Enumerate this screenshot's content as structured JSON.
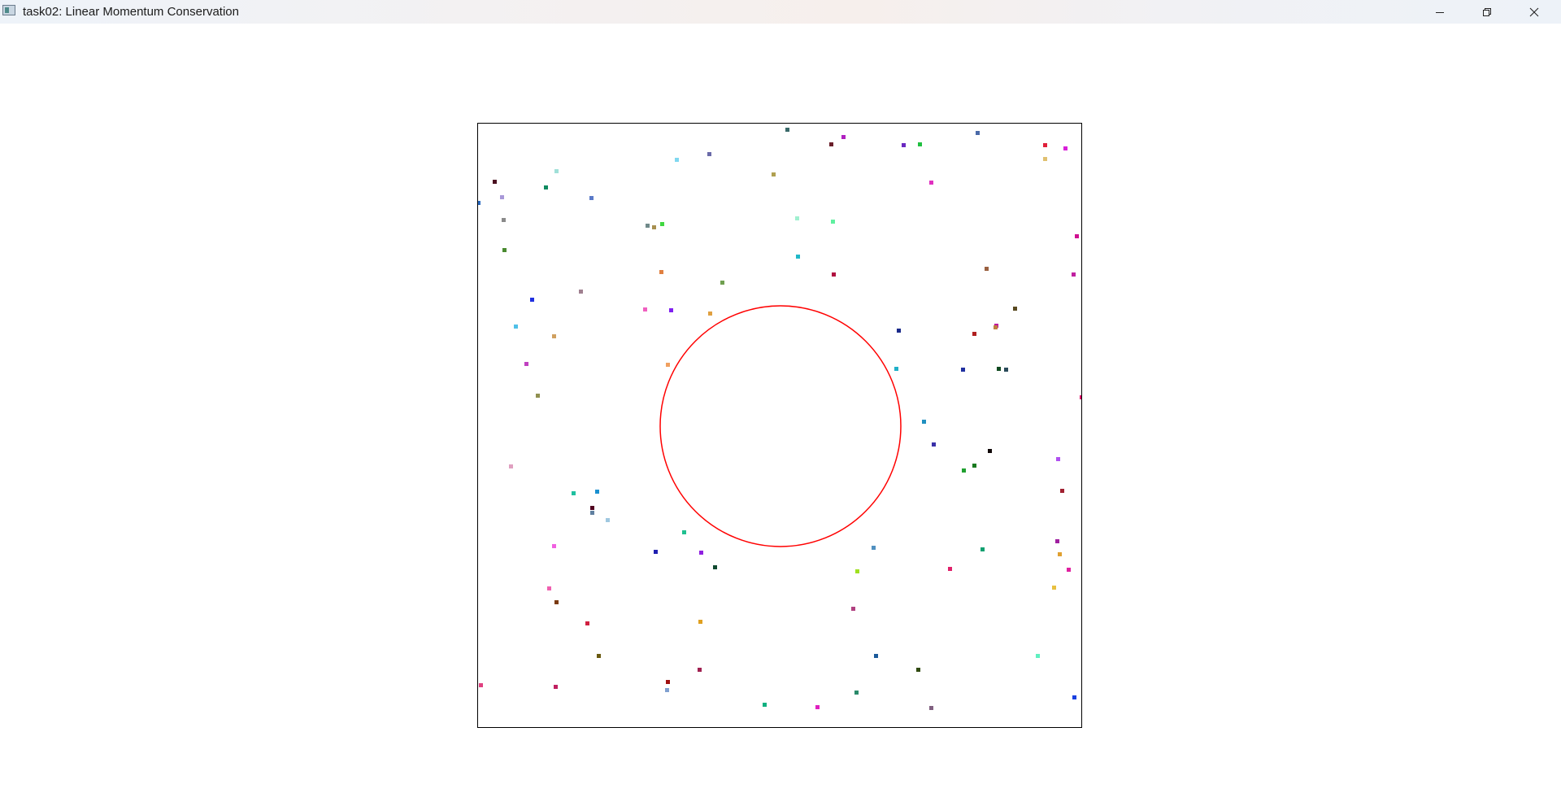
{
  "window": {
    "title": "task02: Linear Momentum Conservation",
    "controls": [
      "minimize",
      "restore",
      "close"
    ]
  },
  "simulation": {
    "circle_color": "#ff0000",
    "border_color": "#000000",
    "particles": [
      {
        "color": "#3a6a6a"
      },
      {
        "color": "#6a1f2a"
      },
      {
        "color": "#b020c0"
      },
      {
        "color": "#6a28c0"
      },
      {
        "color": "#20c040"
      },
      {
        "color": "#4a6aa8"
      },
      {
        "color": "#e0203a"
      },
      {
        "color": "#d820d8"
      },
      {
        "color": "#e0c070"
      },
      {
        "color": "#80d8f0"
      },
      {
        "color": "#6a6aa8"
      },
      {
        "color": "#b0a050"
      },
      {
        "color": "#e030c0"
      },
      {
        "color": "#a0e0d8"
      },
      {
        "color": "#4a1020"
      },
      {
        "color": "#108a60"
      },
      {
        "color": "#5a7ac8"
      },
      {
        "color": "#a898d8"
      },
      {
        "color": "#2a6ac0"
      },
      {
        "color": "#8a8a8a"
      },
      {
        "color": "#a0f0d0"
      },
      {
        "color": "#60f0a0"
      },
      {
        "color": "#708a8a"
      },
      {
        "color": "#a89050"
      },
      {
        "color": "#40d840"
      },
      {
        "color": "#d01090"
      },
      {
        "color": "#4a8a30"
      },
      {
        "color": "#20b8c8"
      },
      {
        "color": "#b01040"
      },
      {
        "color": "#c010a0"
      },
      {
        "color": "#c020a0"
      },
      {
        "color": "#9a6040"
      },
      {
        "color": "#e08040"
      },
      {
        "color": "#70a050"
      },
      {
        "color": "#a08090"
      },
      {
        "color": "#5a4a20"
      },
      {
        "color": "#2030e0"
      },
      {
        "color": "#f060c0"
      },
      {
        "color": "#8020f0"
      },
      {
        "color": "#e0a040"
      },
      {
        "color": "#50c0e8"
      },
      {
        "color": "#d0a060"
      },
      {
        "color": "#1a2a8a"
      },
      {
        "color": "#b02020"
      },
      {
        "color": "#c08040"
      },
      {
        "color": "#c040c0"
      },
      {
        "color": "#f0a060"
      },
      {
        "color": "#20b0c8"
      },
      {
        "color": "#2030a0"
      },
      {
        "color": "#104a20"
      },
      {
        "color": "#2a4a5a"
      },
      {
        "color": "#e0106a"
      },
      {
        "color": "#909050"
      },
      {
        "color": "#2090c0"
      },
      {
        "color": "#3a30a8"
      },
      {
        "color": "#100808"
      },
      {
        "color": "#e0a0c0"
      },
      {
        "color": "#b050f0"
      },
      {
        "color": "#1a7a20"
      },
      {
        "color": "#20a030"
      },
      {
        "color": "#20c0a0"
      },
      {
        "color": "#1a90d0"
      },
      {
        "color": "#a02030"
      },
      {
        "color": "#500020"
      },
      {
        "color": "#6080a0"
      },
      {
        "color": "#a0c8e0"
      },
      {
        "color": "#20c090"
      },
      {
        "color": "#f060e0"
      },
      {
        "color": "#2020b0"
      },
      {
        "color": "#5090c0"
      },
      {
        "color": "#9020e0"
      },
      {
        "color": "#10a070"
      },
      {
        "color": "#a020a0"
      },
      {
        "color": "#e0a030"
      },
      {
        "color": "#104a30"
      },
      {
        "color": "#e020a0"
      },
      {
        "color": "#e0206a"
      },
      {
        "color": "#a0e020"
      },
      {
        "color": "#e8c040"
      },
      {
        "color": "#f060b0"
      },
      {
        "color": "#b04080"
      },
      {
        "color": "#7a3a10"
      },
      {
        "color": "#d02040"
      },
      {
        "color": "#e0a020"
      },
      {
        "color": "#1a5a9a"
      },
      {
        "color": "#6a5a10"
      },
      {
        "color": "#60f0c0"
      },
      {
        "color": "#e04080"
      },
      {
        "color": "#c02060"
      },
      {
        "color": "#a01010"
      },
      {
        "color": "#a02050"
      },
      {
        "color": "#80a0d0"
      },
      {
        "color": "#304a10"
      },
      {
        "color": "#2a8a6a"
      },
      {
        "color": "#10b080"
      },
      {
        "color": "#e020c0"
      },
      {
        "color": "#806080"
      },
      {
        "color": "#1a40e0"
      }
    ]
  }
}
